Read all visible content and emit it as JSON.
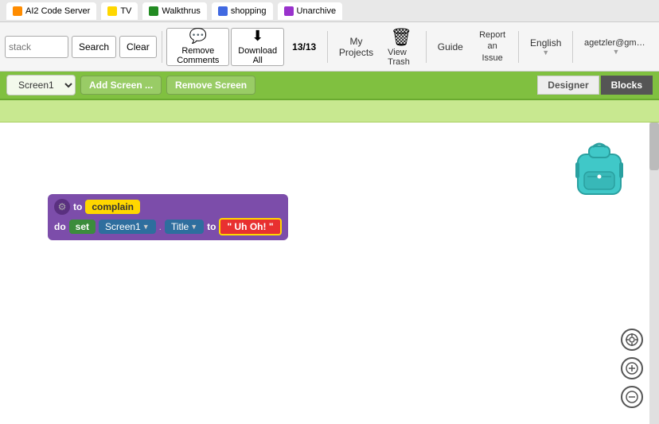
{
  "tabs": [
    {
      "label": "AI2 Code Server",
      "color": "#ff8c00"
    },
    {
      "label": "TV",
      "color": "#ffd700"
    },
    {
      "label": "Walkthrus",
      "color": "#228b22"
    },
    {
      "label": "shopping",
      "color": "#4169e1"
    },
    {
      "label": "Unarchive",
      "color": "#9932cc"
    }
  ],
  "toolbar": {
    "search_placeholder": "stack",
    "search_label": "Search",
    "clear_label": "Clear",
    "remove_comments_label": "Remove Comments",
    "download_all_label": "Download All",
    "counter": "13/13",
    "my_projects_label": "My Projects",
    "view_trash_label": "View Trash",
    "guide_label": "Guide",
    "report_issue_label": "Report an Issue",
    "english_label": "English",
    "user_label": "agetzler@gmail.com",
    "trash_label": "Trash",
    "trash_icon": "🗑"
  },
  "screen_toolbar": {
    "screen1_label": "Screen1",
    "add_screen_label": "Add Screen ...",
    "remove_screen_label": "Remove Screen",
    "designer_label": "Designer",
    "blocks_label": "Blocks"
  },
  "blocks": {
    "to_label": "to",
    "complain_label": "complain",
    "do_label": "do",
    "set_label": "set",
    "screen1_label": "Screen1",
    "title_label": "Title",
    "to2_label": "to",
    "string_open": "\"",
    "uh_oh_label": "Uh Oh!",
    "string_close": "\""
  },
  "zoom": {
    "target_symbol": "⊕",
    "plus_symbol": "+",
    "minus_symbol": "−"
  }
}
